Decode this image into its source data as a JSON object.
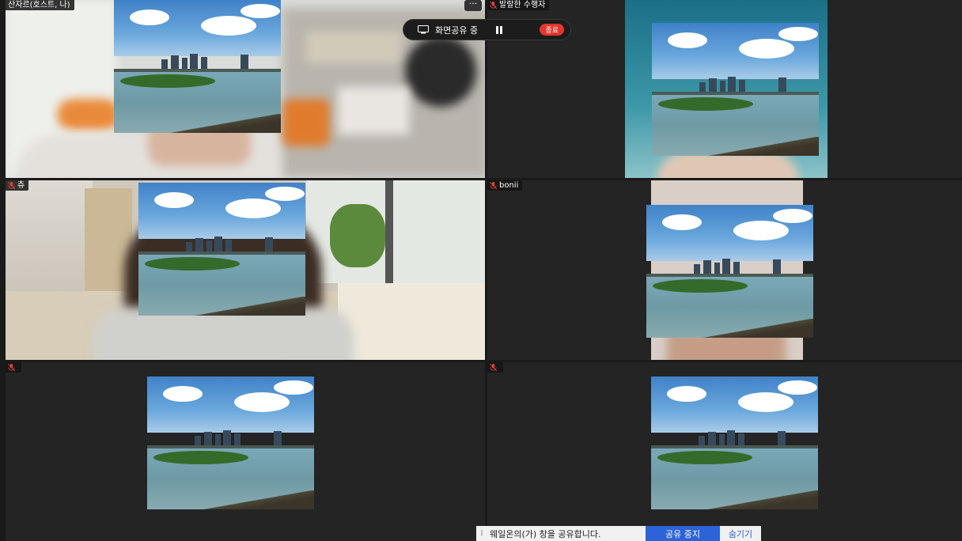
{
  "participants": [
    {
      "name": "산자르(호스트, 나)",
      "mic_muted": false
    },
    {
      "name": "발랄한 수행자",
      "mic_muted": true
    },
    {
      "name": "츄",
      "mic_muted": true
    },
    {
      "name": "bonii",
      "mic_muted": true
    },
    {
      "name": "",
      "mic_muted": true
    },
    {
      "name": "",
      "mic_muted": true
    }
  ],
  "toolbar": {
    "status_label": "화면공유 중",
    "pause_icon": "pause-icon",
    "end_label": "종료",
    "more_label": "···"
  },
  "share_bar": {
    "message": "웨일온의(가) 창을 공유합니다.",
    "stop_label": "공유 중지",
    "hide_label": "숨기기"
  },
  "colors": {
    "end_button": "#e5352c",
    "stop_button": "#2d63d8",
    "muted_mic": "#d9403a",
    "tile_bg": "#242424"
  }
}
